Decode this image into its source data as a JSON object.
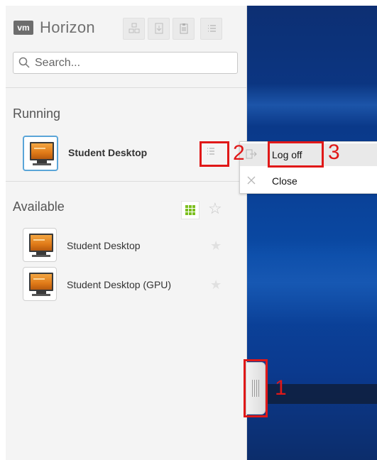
{
  "app": {
    "logo_text": "vm",
    "title": "Horizon"
  },
  "toolbar": {
    "buttons": [
      {
        "name": "apps-icon"
      },
      {
        "name": "shortcut-icon"
      },
      {
        "name": "clipboard-icon"
      },
      {
        "name": "list-menu-icon"
      }
    ]
  },
  "search": {
    "placeholder": "Search..."
  },
  "running": {
    "title": "Running",
    "items": [
      {
        "label": "Student Desktop"
      }
    ]
  },
  "available": {
    "title": "Available",
    "items": [
      {
        "label": "Student Desktop"
      },
      {
        "label": "Student Desktop (GPU)"
      }
    ]
  },
  "context_menu": {
    "items": [
      {
        "label": "Log off",
        "icon": "logoff-icon"
      },
      {
        "label": "Close",
        "icon": "close-icon"
      }
    ]
  },
  "annotations": {
    "n1": "1",
    "n2": "2",
    "n3": "3",
    "color": "#e01818"
  },
  "colors": {
    "selection": "#5aa5d8",
    "grid_green": "#7cbf1f"
  }
}
